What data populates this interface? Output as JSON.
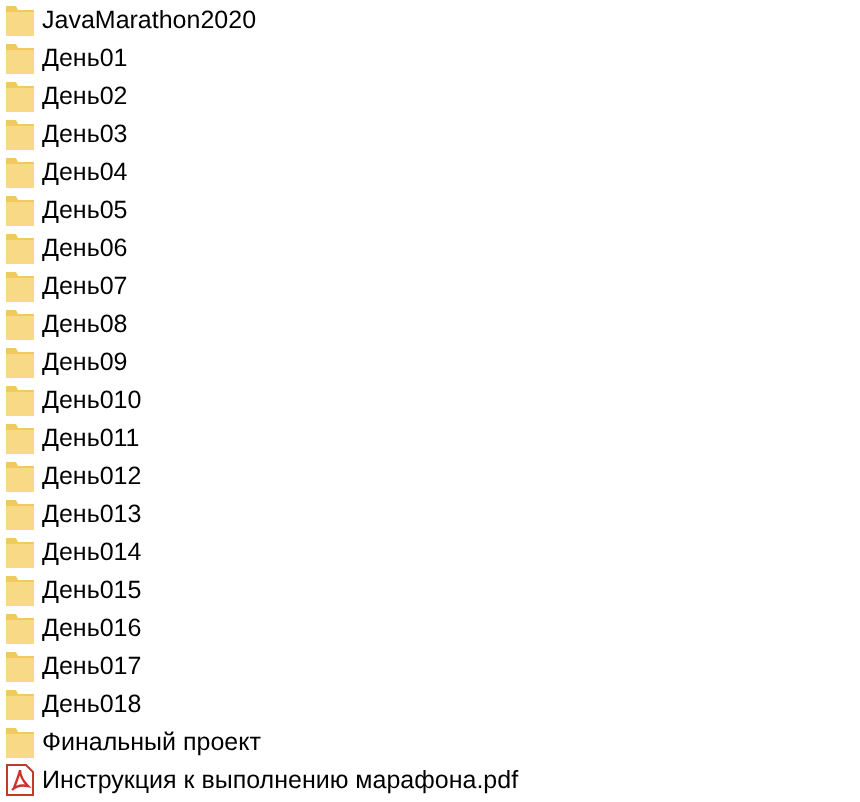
{
  "files": [
    {
      "name": "JavaMarathon2020",
      "kind": "folder"
    },
    {
      "name": "День01",
      "kind": "folder"
    },
    {
      "name": "День02",
      "kind": "folder"
    },
    {
      "name": "День03",
      "kind": "folder"
    },
    {
      "name": "День04",
      "kind": "folder"
    },
    {
      "name": "День05",
      "kind": "folder"
    },
    {
      "name": "День06",
      "kind": "folder"
    },
    {
      "name": "День07",
      "kind": "folder"
    },
    {
      "name": "День08",
      "kind": "folder"
    },
    {
      "name": "День09",
      "kind": "folder"
    },
    {
      "name": "День010",
      "kind": "folder"
    },
    {
      "name": "День011",
      "kind": "folder"
    },
    {
      "name": "День012",
      "kind": "folder"
    },
    {
      "name": "День013",
      "kind": "folder"
    },
    {
      "name": "День014",
      "kind": "folder"
    },
    {
      "name": "День015",
      "kind": "folder"
    },
    {
      "name": "День016",
      "kind": "folder"
    },
    {
      "name": "День017",
      "kind": "folder"
    },
    {
      "name": "День018",
      "kind": "folder"
    },
    {
      "name": "Финальный проект",
      "kind": "folder"
    },
    {
      "name": "Инструкция к выполнению марафона.pdf",
      "kind": "pdf"
    }
  ]
}
